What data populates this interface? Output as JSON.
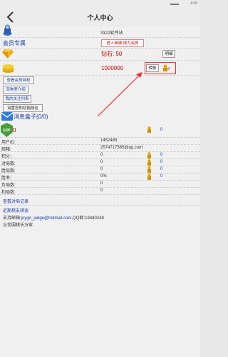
{
  "status": {
    "time": "4:36"
  },
  "header": {
    "title": "个人中心"
  },
  "site": {
    "name": "3322软件站"
  },
  "vip": {
    "label": "会员专属",
    "promo": "进入商城 成为会员",
    "diamond": "钻石: 50",
    "detail_btn": "明细"
  },
  "coins": {
    "value": "1000000",
    "transfer_btn": "转账"
  },
  "links": [
    "查看会员特权",
    "宠物室介绍",
    "我的关注列表",
    "设置您的初始段位"
  ],
  "message": {
    "label": "消息盒子(0/0)"
  },
  "exp": {
    "value": "0"
  },
  "zero_badge": "0",
  "profile": {
    "user_id_label": "用户ID:",
    "user_id": "1452485",
    "email_label": "邮箱:",
    "email": "2574717565@qq.com",
    "rows": [
      {
        "label": "积分:",
        "value": "0"
      },
      {
        "label": "对局数:",
        "value": "0"
      },
      {
        "label": "胜局数:",
        "value": "0"
      },
      {
        "label": "胜率:",
        "value": "0%"
      },
      {
        "label": "负局数:",
        "value": "0"
      },
      {
        "label": "和局数:",
        "value": "0"
      }
    ]
  },
  "footer": {
    "history_link": "查看对局记录",
    "nearby_link": "近期棋友棋谈",
    "support_prefix": "支持邮箱:",
    "support_email": "joygo_judge@hotmail.com",
    "support_qq": ",QQ群:19480248",
    "slogan": "忘忧围棋乐万家"
  },
  "colors": {
    "accent_red": "#cc0000",
    "link_blue": "#1a3ca8",
    "highlight": "#ee3333"
  }
}
